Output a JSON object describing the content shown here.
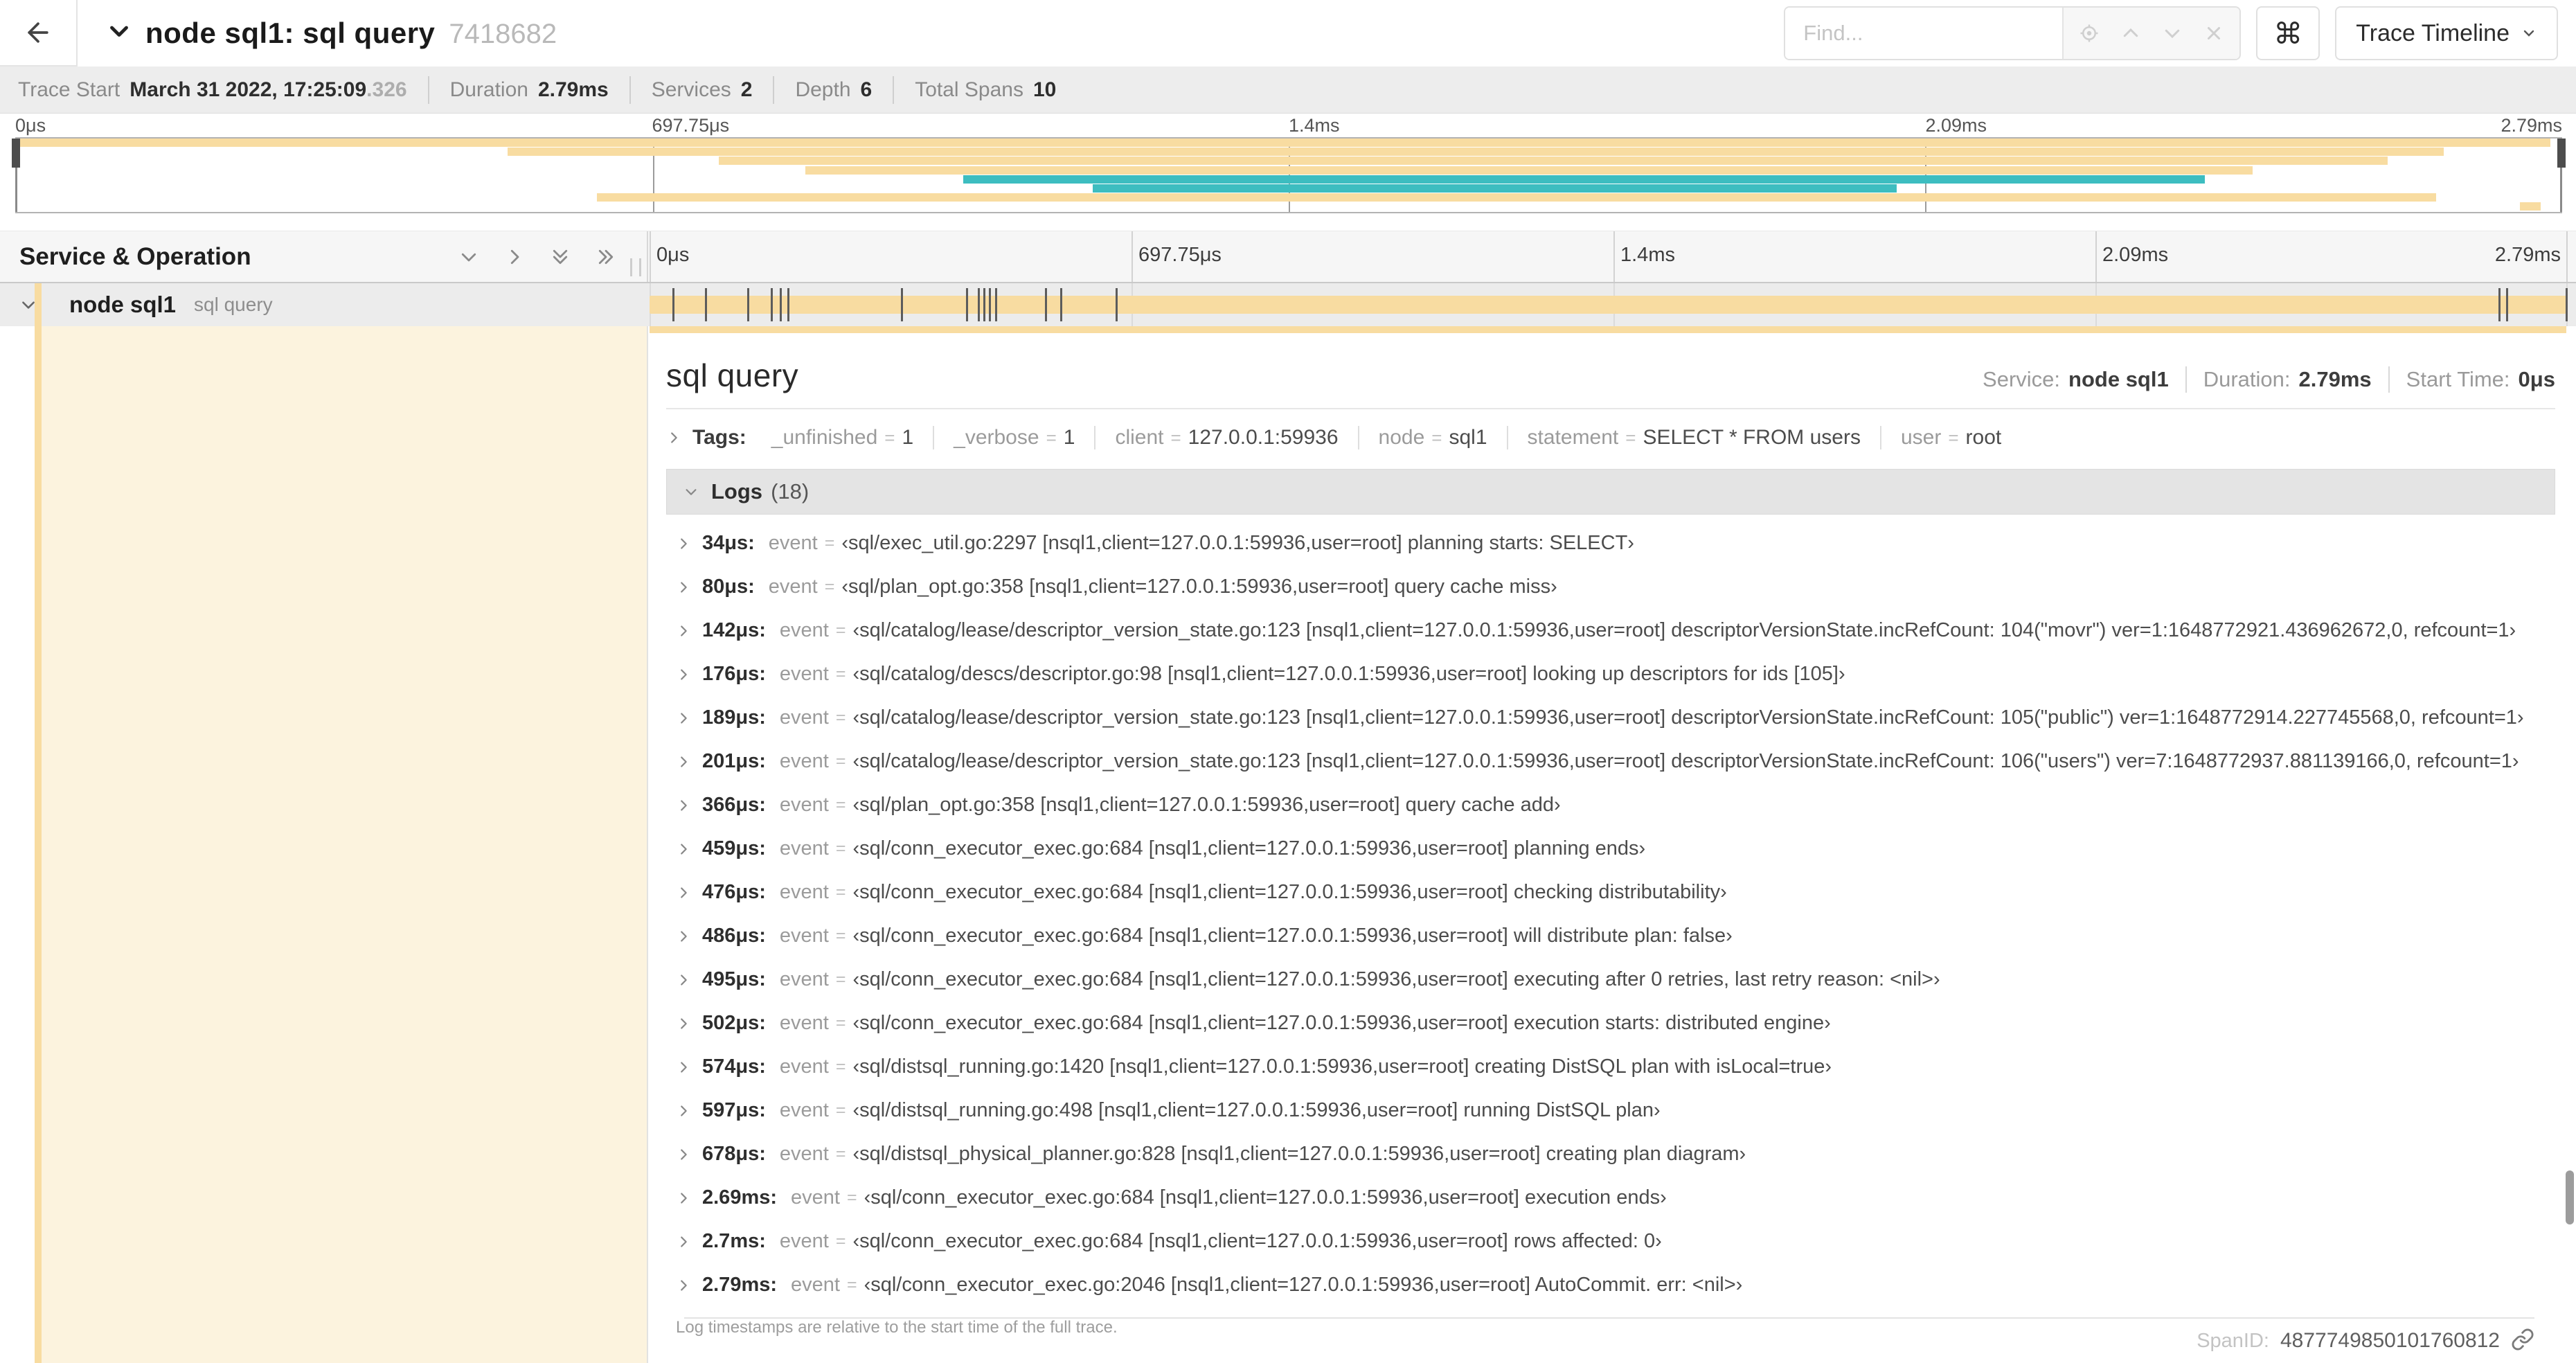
{
  "colors": {
    "tan": "#F8DCA1",
    "teal": "#3DBDC0",
    "cream": "#FCF3DE"
  },
  "topbar": {
    "title": "node sql1: sql query",
    "trace_id": "7418682",
    "find_placeholder": "Find...",
    "shortcut_button": "⌘",
    "view_select": "Trace Timeline"
  },
  "infobar": {
    "items": [
      {
        "label": "Trace Start",
        "value": "March 31 2022, 17:25:09",
        "suffix": ".326"
      },
      {
        "label": "Duration",
        "value": "2.79ms"
      },
      {
        "label": "Services",
        "value": "2"
      },
      {
        "label": "Depth",
        "value": "6"
      },
      {
        "label": "Total Spans",
        "value": "10"
      }
    ]
  },
  "timeline": {
    "ticks": [
      {
        "label": "0μs",
        "pct": 0
      },
      {
        "label": "697.75μs",
        "pct": 25
      },
      {
        "label": "1.4ms",
        "pct": 50
      },
      {
        "label": "2.09ms",
        "pct": 75
      },
      {
        "label": "2.79ms",
        "pct": 100
      }
    ],
    "minimap_rows": [
      {
        "start": 0,
        "end": 99.6,
        "color": "tan"
      },
      {
        "start": 19.3,
        "end": 95.4,
        "color": "tan"
      },
      {
        "start": 27.6,
        "end": 93.2,
        "color": "tan"
      },
      {
        "start": 31.0,
        "end": 87.9,
        "color": "tan"
      },
      {
        "start": 37.2,
        "end": 86.0,
        "color": "teal"
      },
      {
        "start": 42.3,
        "end": 73.9,
        "color": "teal"
      },
      {
        "start": 22.8,
        "end": 95.1,
        "color": "tan"
      },
      {
        "start": 98.4,
        "end": 99.2,
        "color": "tan"
      }
    ]
  },
  "grid": {
    "left_header": "Service & Operation"
  },
  "span_row": {
    "service": "node sql1",
    "operation": "sql query",
    "bar": {
      "start": 0,
      "end": 100
    },
    "log_marks": [
      1.2,
      2.9,
      5.1,
      6.3,
      6.8,
      7.2,
      13.1,
      16.5,
      17.1,
      17.4,
      17.7,
      18.0,
      20.6,
      21.4,
      24.3,
      96.4,
      96.8,
      99.9
    ]
  },
  "detail": {
    "operation": "sql query",
    "meta": [
      {
        "label": "Service:",
        "value": "node sql1"
      },
      {
        "label": "Duration:",
        "value": "2.79ms"
      },
      {
        "label": "Start Time:",
        "value": "0μs"
      }
    ],
    "tags_label": "Tags:",
    "tags": [
      {
        "key": "_unfinished",
        "value": "1"
      },
      {
        "key": "_verbose",
        "value": "1"
      },
      {
        "key": "client",
        "value": "127.0.0.1:59936"
      },
      {
        "key": "node",
        "value": "sql1"
      },
      {
        "key": "statement",
        "value": "SELECT * FROM users"
      },
      {
        "key": "user",
        "value": "root"
      }
    ],
    "logs_label": "Logs",
    "logs_count": "(18)",
    "logs": [
      {
        "time": "34μs:",
        "field": "event",
        "value": "‹sql/exec_util.go:2297 [nsql1,client=127.0.0.1:59936,user=root] planning starts: SELECT›"
      },
      {
        "time": "80μs:",
        "field": "event",
        "value": "‹sql/plan_opt.go:358 [nsql1,client=127.0.0.1:59936,user=root] query cache miss›"
      },
      {
        "time": "142μs:",
        "field": "event",
        "value": "‹sql/catalog/lease/descriptor_version_state.go:123 [nsql1,client=127.0.0.1:59936,user=root] descriptorVersionState.incRefCount: 104(\"movr\") ver=1:1648772921.436962672,0, refcount=1›"
      },
      {
        "time": "176μs:",
        "field": "event",
        "value": "‹sql/catalog/descs/descriptor.go:98 [nsql1,client=127.0.0.1:59936,user=root] looking up descriptors for ids [105]›"
      },
      {
        "time": "189μs:",
        "field": "event",
        "value": "‹sql/catalog/lease/descriptor_version_state.go:123 [nsql1,client=127.0.0.1:59936,user=root] descriptorVersionState.incRefCount: 105(\"public\") ver=1:1648772914.227745568,0, refcount=1›"
      },
      {
        "time": "201μs:",
        "field": "event",
        "value": "‹sql/catalog/lease/descriptor_version_state.go:123 [nsql1,client=127.0.0.1:59936,user=root] descriptorVersionState.incRefCount: 106(\"users\") ver=7:1648772937.881139166,0, refcount=1›"
      },
      {
        "time": "366μs:",
        "field": "event",
        "value": "‹sql/plan_opt.go:358 [nsql1,client=127.0.0.1:59936,user=root] query cache add›"
      },
      {
        "time": "459μs:",
        "field": "event",
        "value": "‹sql/conn_executor_exec.go:684 [nsql1,client=127.0.0.1:59936,user=root] planning ends›"
      },
      {
        "time": "476μs:",
        "field": "event",
        "value": "‹sql/conn_executor_exec.go:684 [nsql1,client=127.0.0.1:59936,user=root] checking distributability›"
      },
      {
        "time": "486μs:",
        "field": "event",
        "value": "‹sql/conn_executor_exec.go:684 [nsql1,client=127.0.0.1:59936,user=root] will distribute plan: false›"
      },
      {
        "time": "495μs:",
        "field": "event",
        "value": "‹sql/conn_executor_exec.go:684 [nsql1,client=127.0.0.1:59936,user=root] executing after 0 retries, last retry reason: <nil>›"
      },
      {
        "time": "502μs:",
        "field": "event",
        "value": "‹sql/conn_executor_exec.go:684 [nsql1,client=127.0.0.1:59936,user=root] execution starts: distributed engine›"
      },
      {
        "time": "574μs:",
        "field": "event",
        "value": "‹sql/distsql_running.go:1420 [nsql1,client=127.0.0.1:59936,user=root] creating DistSQL plan with isLocal=true›"
      },
      {
        "time": "597μs:",
        "field": "event",
        "value": "‹sql/distsql_running.go:498 [nsql1,client=127.0.0.1:59936,user=root] running DistSQL plan›"
      },
      {
        "time": "678μs:",
        "field": "event",
        "value": "‹sql/distsql_physical_planner.go:828 [nsql1,client=127.0.0.1:59936,user=root] creating plan diagram›"
      },
      {
        "time": "2.69ms:",
        "field": "event",
        "value": "‹sql/conn_executor_exec.go:684 [nsql1,client=127.0.0.1:59936,user=root] execution ends›"
      },
      {
        "time": "2.7ms:",
        "field": "event",
        "value": "‹sql/conn_executor_exec.go:684 [nsql1,client=127.0.0.1:59936,user=root] rows affected: 0›"
      },
      {
        "time": "2.79ms:",
        "field": "event",
        "value": "‹sql/conn_executor_exec.go:2046 [nsql1,client=127.0.0.1:59936,user=root] AutoCommit. err: <nil>›"
      }
    ],
    "logs_note": "Log timestamps are relative to the start time of the full trace.",
    "span_id_label": "SpanID:",
    "span_id": "4877749850101760812"
  }
}
